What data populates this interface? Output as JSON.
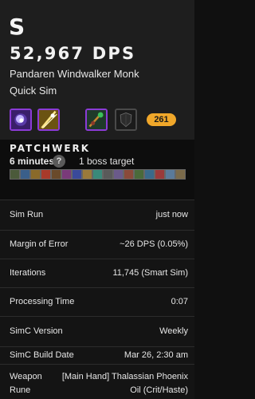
{
  "header": {
    "grade": "S",
    "dps": "52,967 DPS",
    "spec": "Pandaren Windwalker Monk",
    "sim_type": "Quick Sim",
    "item_level": "261",
    "talent_icons": [
      "weapon-gem-icon",
      "storm-strike-icon",
      "dragon-staff-icon",
      "dark-shield-icon"
    ]
  },
  "fight": {
    "title": "PATCHWERK",
    "length": "6 minutes",
    "help": "?",
    "targets": "1 boss target",
    "buff_icons": [
      "buff-1-icon",
      "buff-2-icon",
      "buff-3-icon",
      "buff-4-icon",
      "buff-5-icon",
      "buff-6-icon",
      "buff-7-icon",
      "buff-8-icon",
      "buff-9-icon",
      "buff-10-icon",
      "buff-11-icon",
      "buff-12-icon",
      "buff-13-icon",
      "buff-14-icon",
      "buff-15-icon",
      "buff-16-icon",
      "buff-17-icon"
    ]
  },
  "stats": {
    "sim_run": {
      "label": "Sim Run",
      "value": "just now"
    },
    "margin": {
      "label": "Margin of Error",
      "value": "~26 DPS (0.05%)"
    },
    "iterations": {
      "label": "Iterations",
      "value": "11,745 (Smart Sim)"
    },
    "processing": {
      "label": "Processing Time",
      "value": "0:07"
    },
    "simc_version": {
      "label": "SimC Version",
      "value": "Weekly"
    },
    "simc_build": {
      "label": "SimC Build Date",
      "value": "Mar 26, 2:30 am"
    },
    "weapon_rune": {
      "label_line1": "Weapon",
      "label_line2": "Rune",
      "value_line1": "[Main Hand] Thalassian Phoenix",
      "value_line2": "Oil (Crit/Haste)"
    }
  },
  "colors": {
    "header_bg": "#1e1e1e",
    "ilvl_badge": "#f0a72a",
    "talent_border": "#8b3bd6"
  }
}
